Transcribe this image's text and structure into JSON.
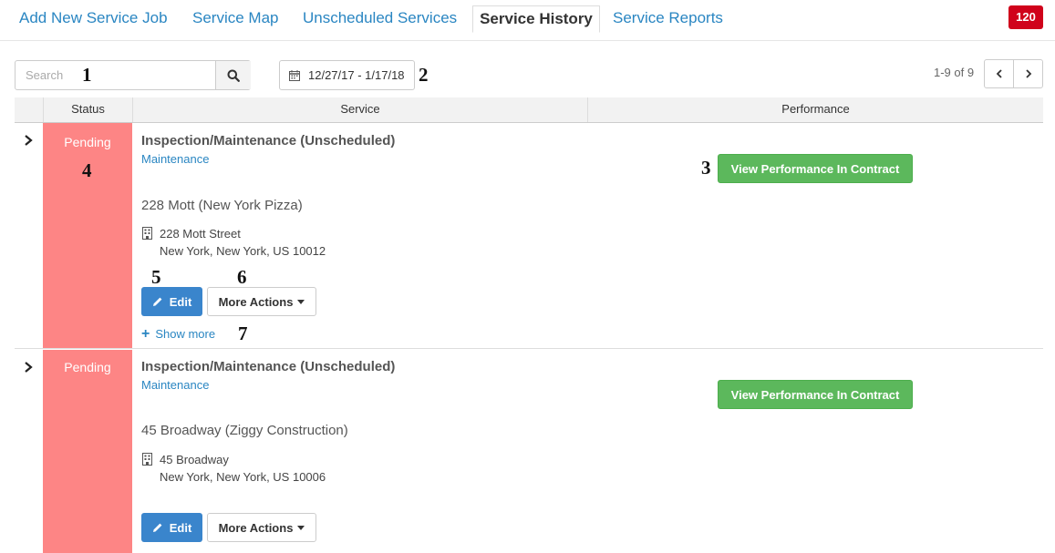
{
  "nav": {
    "links": [
      "Add New Service Job",
      "Service Map",
      "Unscheduled Services",
      "Service History",
      "Service Reports"
    ],
    "active_tab": "Service History",
    "badge": "120"
  },
  "toolbar": {
    "search_placeholder": "Search",
    "date_range": "12/27/17 - 1/17/18",
    "pager_text": "1-9 of 9"
  },
  "table": {
    "headers": [
      "Status",
      "Service",
      "Performance"
    ]
  },
  "rows": [
    {
      "status": "Pending",
      "title": "Inspection/Maintenance (Unscheduled)",
      "type": "Maintenance",
      "location": "228 Mott (New York Pizza)",
      "address_line1": "228 Mott Street",
      "address_line2": "New York, New York, US 10012",
      "edit_label": "Edit",
      "more_label": "More Actions",
      "perf_label": "View Performance In Contract",
      "show_more_label": "Show more"
    },
    {
      "status": "Pending",
      "title": "Inspection/Maintenance (Unscheduled)",
      "type": "Maintenance",
      "location": "45 Broadway (Ziggy Construction)",
      "address_line1": "45 Broadway",
      "address_line2": "New York, New York, US 10006",
      "edit_label": "Edit",
      "more_label": "More Actions",
      "perf_label": "View Performance In Contract"
    }
  ],
  "annotations": [
    "1",
    "2",
    "3",
    "4",
    "5",
    "6",
    "7"
  ],
  "colors": {
    "link": "#2a86c2",
    "status_pending": "#fd8585",
    "badge": "#d0021b",
    "edit_button": "#3a85cc",
    "performance_button": "#5cb85c"
  },
  "icons": [
    "search-icon",
    "calendar-icon",
    "chevron-left-icon",
    "chevron-right-icon",
    "chevron-right-expand-icon",
    "building-icon",
    "pencil-icon",
    "caret-down-icon",
    "plus-icon"
  ]
}
